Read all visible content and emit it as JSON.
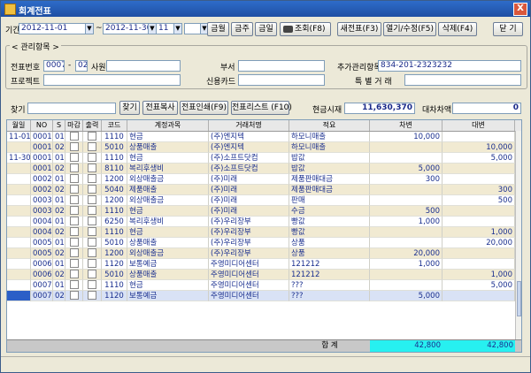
{
  "window": {
    "title": "회계전표",
    "close_label": "X"
  },
  "toolbar": {
    "period_label": "기간",
    "date_from": "2012-11-01",
    "tilde": "~",
    "date_to": "2012-11-30",
    "month_value": "11",
    "extra_value": "",
    "btn_month": "금월",
    "btn_week": "금주",
    "btn_today": "금일",
    "btn_search": "조회(F8)",
    "btn_new": "새전표(F3)",
    "btn_open": "열기/수정(F5)",
    "btn_delete": "삭제(F4)",
    "btn_close": "닫 기"
  },
  "mgmt": {
    "group_label": "< 관리항목 >",
    "slip_no_label": "전표번호",
    "slip_no_value": "0007",
    "slip_no_dash": "-",
    "slip_no_sub": "02",
    "employee_label": "사원",
    "employee_value": "",
    "dept_label": "부서",
    "dept_value": "",
    "extra_mgmt_label": "추가관리항목",
    "extra_mgmt_value": "834-201-2323232",
    "project_label": "프로젝트",
    "project_value": "",
    "card_label": "신용카드",
    "card_value": "",
    "special_label": "특 별 거 래",
    "special_value": ""
  },
  "searchbar": {
    "find_label": "찾기",
    "find_value": "",
    "btn_find": "찾기",
    "btn_copy": "전표복사",
    "btn_print": "전표인쇄(F9)",
    "btn_list": "전표리스트 (F10)",
    "cash_label": "현금시재",
    "cash_value": "11,630,370",
    "diff_label": "대차차액",
    "diff_value": "0"
  },
  "columns": [
    "월일",
    "NO",
    "S",
    "마감",
    "출력",
    "코드",
    "계정과목",
    "거래처명",
    "적요",
    "차변",
    "대변"
  ],
  "rows": [
    {
      "date": "11-01",
      "no": "0001",
      "s": "01",
      "code": "1110",
      "account": "현금",
      "partner": "(주)엔지텍",
      "memo": "하모니매출",
      "debit": "10,000",
      "credit": ""
    },
    {
      "date": "",
      "no": "0001",
      "s": "02",
      "code": "5010",
      "account": "상품매출",
      "partner": "(주)엔지텍",
      "memo": "하모니매출",
      "debit": "",
      "credit": "10,000"
    },
    {
      "date": "11-30",
      "no": "0001",
      "s": "01",
      "code": "1110",
      "account": "현금",
      "partner": "(주)소프트닷컴",
      "memo": "밥값",
      "debit": "",
      "credit": "5,000"
    },
    {
      "date": "",
      "no": "0001",
      "s": "02",
      "code": "8110",
      "account": "복리후생비",
      "partner": "(주)소프트닷컴",
      "memo": "밥값",
      "debit": "5,000",
      "credit": ""
    },
    {
      "date": "",
      "no": "0002",
      "s": "01",
      "code": "1200",
      "account": "외상매출금",
      "partner": "(주)미래",
      "memo": "제품판매대금",
      "debit": "300",
      "credit": ""
    },
    {
      "date": "",
      "no": "0002",
      "s": "02",
      "code": "5040",
      "account": "제품매출",
      "partner": "(주)미래",
      "memo": "제품판매대금",
      "debit": "",
      "credit": "300"
    },
    {
      "date": "",
      "no": "0003",
      "s": "01",
      "code": "1200",
      "account": "외상매출금",
      "partner": "(주)미래",
      "memo": "판매",
      "debit": "",
      "credit": "500"
    },
    {
      "date": "",
      "no": "0003",
      "s": "02",
      "code": "1110",
      "account": "현금",
      "partner": "(주)미래",
      "memo": "수금",
      "debit": "500",
      "credit": ""
    },
    {
      "date": "",
      "no": "0004",
      "s": "01",
      "code": "6250",
      "account": "복리후생비",
      "partner": "(주)우리장부",
      "memo": "빵값",
      "debit": "1,000",
      "credit": ""
    },
    {
      "date": "",
      "no": "0004",
      "s": "02",
      "code": "1110",
      "account": "현금",
      "partner": "(주)우리장부",
      "memo": "빵값",
      "debit": "",
      "credit": "1,000"
    },
    {
      "date": "",
      "no": "0005",
      "s": "01",
      "code": "5010",
      "account": "상품매출",
      "partner": "(주)우리장부",
      "memo": "상품",
      "debit": "",
      "credit": "20,000"
    },
    {
      "date": "",
      "no": "0005",
      "s": "02",
      "code": "1200",
      "account": "외상매출금",
      "partner": "(주)우리장부",
      "memo": "상품",
      "debit": "20,000",
      "credit": ""
    },
    {
      "date": "",
      "no": "0006",
      "s": "01",
      "code": "1120",
      "account": "보통예금",
      "partner": "주영미디어센터",
      "memo": "121212",
      "debit": "1,000",
      "credit": ""
    },
    {
      "date": "",
      "no": "0006",
      "s": "02",
      "code": "5010",
      "account": "상품매출",
      "partner": "주영미디어센터",
      "memo": "121212",
      "debit": "",
      "credit": "1,000"
    },
    {
      "date": "",
      "no": "0007",
      "s": "01",
      "code": "1110",
      "account": "현금",
      "partner": "주영미디어센터",
      "memo": "???",
      "debit": "",
      "credit": "5,000"
    },
    {
      "date": "",
      "no": "0007",
      "s": "02",
      "code": "1120",
      "account": "보통예금",
      "partner": "주영미디어센터",
      "memo": "???",
      "debit": "5,000",
      "credit": ""
    }
  ],
  "totals": {
    "label": "합   계",
    "debit": "42,800",
    "credit": "42,800"
  },
  "colors": {
    "title_bar": "#2e6cc9",
    "row_alt": "#f1ead2",
    "row_selected": "#d9e2f5",
    "row_cursor": "#2b5fc7",
    "total_cell": "#27f0f0",
    "text_value": "#1a2f8f"
  }
}
